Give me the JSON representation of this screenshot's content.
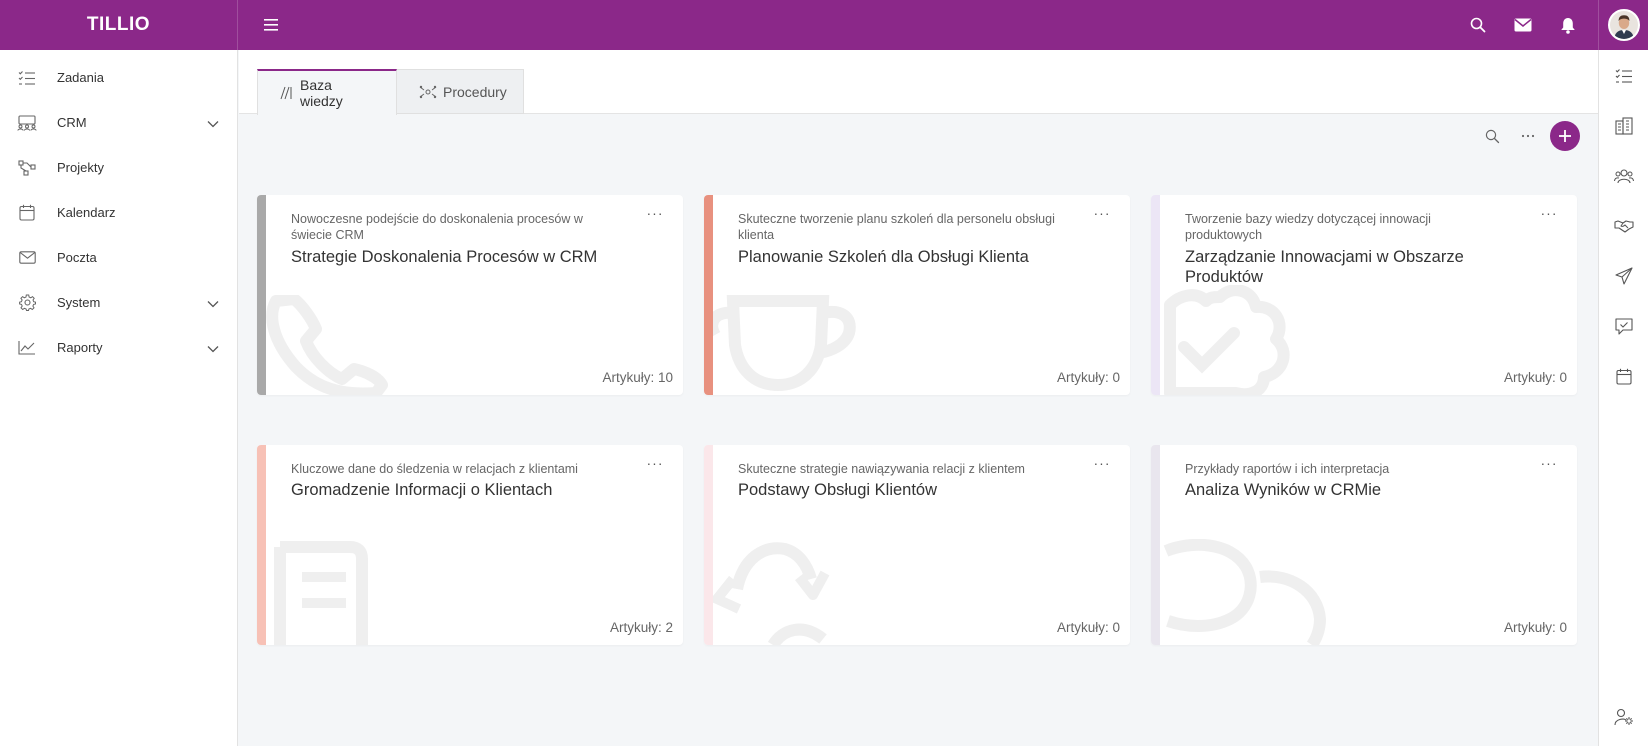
{
  "app": {
    "brand": "TILLIO"
  },
  "sidebar": {
    "items": [
      {
        "label": "Zadania",
        "icon": "tasks-icon",
        "expandable": false
      },
      {
        "label": "CRM",
        "icon": "crm-icon",
        "expandable": true
      },
      {
        "label": "Projekty",
        "icon": "projects-icon",
        "expandable": false
      },
      {
        "label": "Kalendarz",
        "icon": "calendar-icon",
        "expandable": false
      },
      {
        "label": "Poczta",
        "icon": "mail-icon",
        "expandable": false
      },
      {
        "label": "System",
        "icon": "gear-icon",
        "expandable": true
      },
      {
        "label": "Raporty",
        "icon": "chart-icon",
        "expandable": true
      }
    ]
  },
  "tabs": [
    {
      "label": "Baza wiedzy",
      "icon": "knowledge-icon",
      "active": true
    },
    {
      "label": "Procedury",
      "icon": "procedures-icon",
      "active": false
    }
  ],
  "cards": [
    {
      "subtitle": "Nowoczesne podejście do doskonalenia procesów w świecie CRM",
      "title": "Strategie Doskonalenia Procesów w CRM",
      "count": "Artykuły: 10",
      "color": "#a9a9a9",
      "icon": "phone-icon"
    },
    {
      "subtitle": "Skuteczne tworzenie planu szkoleń dla personelu obsługi klienta",
      "title": "Planowanie Szkoleń dla Obsługi Klienta",
      "count": "Artykuły: 0",
      "color": "#e8917f",
      "icon": "trophy-icon"
    },
    {
      "subtitle": "Tworzenie bazy wiedzy dotyczącej innowacji produktowych",
      "title": "Zarządzanie Innowacjami w Obszarze Produktów",
      "count": "Artykuły: 0",
      "color": "#ece6f6",
      "icon": "badge-check-icon"
    },
    {
      "subtitle": "Kluczowe dane do śledzenia w relacjach z klientami",
      "title": "Gromadzenie Informacji o Klientach",
      "count": "Artykuły: 2",
      "color": "#f7c1b6",
      "icon": "document-icon"
    },
    {
      "subtitle": "Skuteczne strategie nawiązywania relacji z klientem",
      "title": "Podstawy Obsługi Klientów",
      "count": "Artykuły: 0",
      "color": "#fbe7ea",
      "icon": "recycle-icon"
    },
    {
      "subtitle": "Przykłady raportów i ich interpretacja",
      "title": "Analiza Wyników w CRMie",
      "count": "Artykuły: 0",
      "color": "#e9e6ee",
      "icon": "comments-icon"
    }
  ],
  "colors": {
    "brand": "#8b2889",
    "background": "#f4f6f8"
  }
}
